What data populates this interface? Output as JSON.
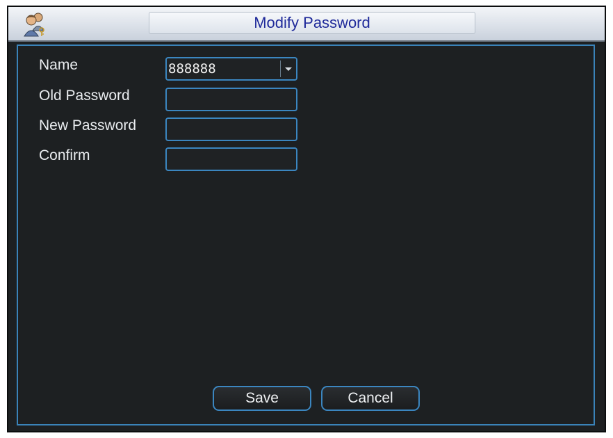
{
  "window": {
    "title": "Modify Password",
    "icon": "users-key-icon"
  },
  "form": {
    "name_label": "Name",
    "name_value": "888888",
    "old_password_label": "Old Password",
    "old_password_value": "",
    "new_password_label": "New Password",
    "new_password_value": "",
    "confirm_label": "Confirm",
    "confirm_value": ""
  },
  "buttons": {
    "save": "Save",
    "cancel": "Cancel"
  },
  "colors": {
    "accent": "#3b86c0",
    "background": "#1d2022",
    "title_text": "#1f2a9a"
  }
}
